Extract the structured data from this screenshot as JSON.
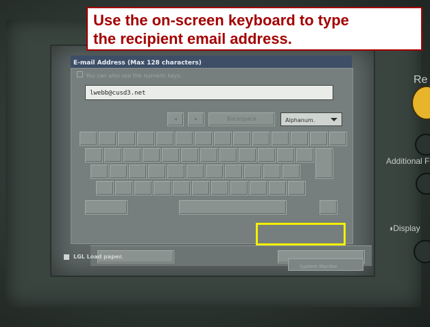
{
  "callout": {
    "line1": "Use the on-screen keyboard to type",
    "line2": "the recipient email address."
  },
  "dialog": {
    "title": "E-mail Address (Max 128 characters)",
    "hint": "You can also use the numeric keys.",
    "email_value": "lwebb@cusd3.net",
    "backspace_label": "Backspace",
    "mode_label": "Alphanum."
  },
  "status": {
    "message": "LGL Load paper.",
    "system_monitor_label": "System Monitor"
  },
  "side_labels": {
    "right_top": "Re",
    "additional": "Additional F",
    "display": "Display"
  },
  "colors": {
    "callout_text": "#a30000",
    "highlight": "#f4f000"
  }
}
